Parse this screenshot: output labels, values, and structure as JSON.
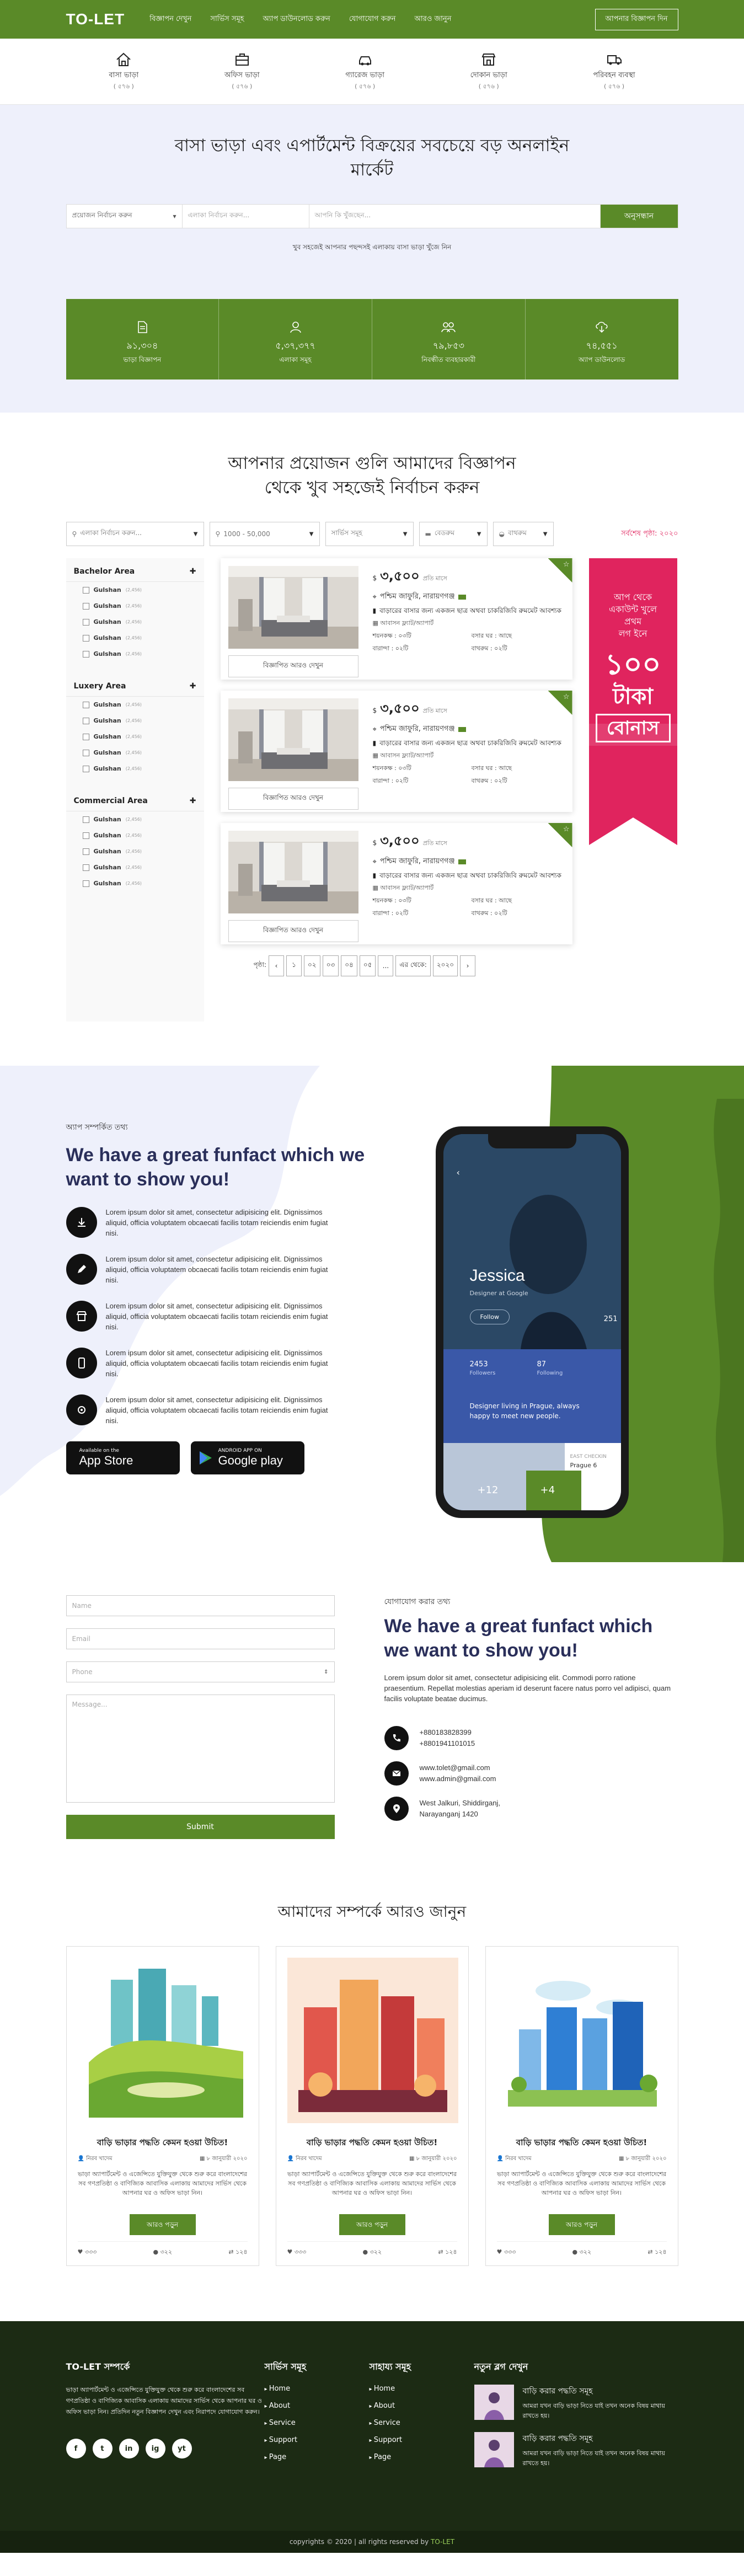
{
  "header": {
    "logo": "TO-LET",
    "nav": [
      "বিজ্ঞাপন দেখুন",
      "সার্ভিস সমূহ",
      "অ্যাপ ডাউনলোড করুন",
      "যোগাযোগ করুন",
      "আরও জানুন"
    ],
    "post_ad": "আপনার বিজ্ঞাপন দিন"
  },
  "categories": [
    {
      "name": "বাসা ভাড়া",
      "count": "( ৫৭৬ )",
      "icon": "house-icon"
    },
    {
      "name": "অফিস ভাড়া",
      "count": "( ৫৭৬ )",
      "icon": "office-icon"
    },
    {
      "name": "গ্যারেজ ভাড়া",
      "count": "( ৫৭৬ )",
      "icon": "garage-icon"
    },
    {
      "name": "দোকান ভাড়া",
      "count": "( ৫৭৬ )",
      "icon": "shop-icon"
    },
    {
      "name": "পরিবহন ব্যবস্থা",
      "count": "( ৫৭৬ )",
      "icon": "truck-icon"
    }
  ],
  "hero": {
    "title": "বাসা ভাড়া এবং এপার্টমেন্ট বিক্রয়ের সবচেয়ে বড় অনলাইন মার্কেট",
    "select": "প্রয়োজন নির্বাচন করুন",
    "location_placeholder": "এলাকা নির্বাচন করুন...",
    "keyword_placeholder": "আপনি কি খুঁজছেন...",
    "search_btn": "অনুসন্ধান",
    "hint": "খুব সহজেই আপনার পছন্দসই এলাকায় বাসা ভাড়া খুঁজে নিন"
  },
  "stats": [
    {
      "value": "৯১,৩০৪",
      "label": "ভাড়া বিজ্ঞাপন",
      "icon": "document-icon"
    },
    {
      "value": "৫,৩৭,৩৭৭",
      "label": "এলাকা সমূহ",
      "icon": "user-icon"
    },
    {
      "value": "৭৯,৮৫৩",
      "label": "নিবন্ধীত ব্যবহারকারী",
      "icon": "users-icon"
    },
    {
      "value": "৭৪,৫৫১",
      "label": "অ্যাপ ডাউনলোড",
      "icon": "download-icon"
    }
  ],
  "listing": {
    "title": "আপনার প্রয়োজন গুলি আমাদের বিজ্ঞাপন থেকে খুব সহজেই নির্বাচন করুন",
    "filters": {
      "area": "এলাকা নির্বাচন করুন...",
      "price": "1000 - 50,000",
      "service": "সার্ভিস সমূহ",
      "room": "বেডরুম",
      "bath": "বাথরুম",
      "special": "সর্বশেষ পৃষ্ঠা: ২০২০"
    },
    "groups": [
      {
        "title": "Bachelor Area",
        "items": [
          {
            "name": "Gulshan",
            "count": "(2,456)"
          },
          {
            "name": "Gulshan",
            "count": "(2,456)"
          },
          {
            "name": "Gulshan",
            "count": "(2,456)"
          },
          {
            "name": "Gulshan",
            "count": "(2,456)"
          },
          {
            "name": "Gulshan",
            "count": "(2,456)"
          }
        ]
      },
      {
        "title": "Luxery Area",
        "items": [
          {
            "name": "Gulshan",
            "count": "(2,456)"
          },
          {
            "name": "Gulshan",
            "count": "(2,456)"
          },
          {
            "name": "Gulshan",
            "count": "(2,456)"
          },
          {
            "name": "Gulshan",
            "count": "(2,456)"
          },
          {
            "name": "Gulshan",
            "count": "(2,456)"
          }
        ]
      },
      {
        "title": "Commercial Area",
        "items": [
          {
            "name": "Gulshan",
            "count": "(2,456)"
          },
          {
            "name": "Gulshan",
            "count": "(2,456)"
          },
          {
            "name": "Gulshan",
            "count": "(2,456)"
          },
          {
            "name": "Gulshan",
            "count": "(2,456)"
          },
          {
            "name": "Gulshan",
            "count": "(2,456)"
          }
        ]
      }
    ],
    "cards": [
      {
        "price": "৩,৫০০",
        "per": "প্রতি মাসে",
        "location": "পশ্চিম জাফুরি, নারায়ণগঞ্জ",
        "title": "বাড়ারের বাসার জন্য একজন ছাত্র অথবা চাকরিজিবি রুমমেট আবশ্যক",
        "type": "আবাসন ফ্ল্যাট/অ্যাপার্ট",
        "f1": "শয়নকক্ষ : ০৩টি",
        "f2": "বসার ঘর : আছে",
        "f3": "বারান্দা : ০২টি",
        "f4": "বাথরুম : ০২টি",
        "details": "বিজ্ঞাপিত আরও দেখুন",
        "badge": "☆"
      },
      {
        "price": "৩,৫০০",
        "per": "প্রতি মাসে",
        "location": "পশ্চিম জাফুরি, নারায়ণগঞ্জ",
        "title": "বাড়ারের বাসার জন্য একজন ছাত্র অথবা চাকরিজিবি রুমমেট আবশ্যক",
        "type": "আবাসন ফ্ল্যাট/অ্যাপার্ট",
        "f1": "শয়নকক্ষ : ০৩টি",
        "f2": "বসার ঘর : আছে",
        "f3": "বারান্দা : ০২টি",
        "f4": "বাথরুম : ০২টি",
        "details": "বিজ্ঞাপিত আরও দেখুন",
        "badge": "☆"
      },
      {
        "price": "৩,৫০০",
        "per": "প্রতি মাসে",
        "location": "পশ্চিম জাফুরি, নারায়ণগঞ্জ",
        "title": "বাড়ারের বাসার জন্য একজন ছাত্র অথবা চাকরিজিবি রুমমেট আবশ্যক",
        "type": "আবাসন ফ্ল্যাট/অ্যাপার্ট",
        "f1": "শয়নকক্ষ : ০৩টি",
        "f2": "বসার ঘর : আছে",
        "f3": "বারান্দা : ০২টি",
        "f4": "বাথরুম : ০২টি",
        "details": "বিজ্ঞাপিত আরও দেখুন",
        "badge": "☆"
      }
    ],
    "pager": {
      "label": "পৃষ্ঠা:",
      "pages": [
        "‹",
        "১",
        "০২",
        "০৩",
        "০৪",
        "০৫",
        "...",
        "এর থেকে:",
        "২০২০",
        "›"
      ]
    },
    "ad": {
      "line1": "আপ থেকে",
      "line2": "একাউন্ট খুলে",
      "line3": "প্রথম",
      "line4": "লগ ইনে",
      "amount": "১০০",
      "unit": "টাকা",
      "bonus": "বোনাস"
    }
  },
  "funfact": {
    "eyebrow": "অ্যাপ সম্পর্কিত তথ্য",
    "title": "We have a great funfact which we want to show you!",
    "items": [
      {
        "text": "Lorem ipsum dolor sit amet, consectetur adipisicing elit. Dignissimos aliquid, officia voluptatem obcaecati facilis totam reiciendis enim fugiat nisi.",
        "icon": "download-icon"
      },
      {
        "text": "Lorem ipsum dolor sit amet, consectetur adipisicing elit. Dignissimos aliquid, officia voluptatem obcaecati facilis totam reiciendis enim fugiat nisi.",
        "icon": "pencil-icon"
      },
      {
        "text": "Lorem ipsum dolor sit amet, consectetur adipisicing elit. Dignissimos aliquid, officia voluptatem obcaecati facilis totam reiciendis enim fugiat nisi.",
        "icon": "store-icon"
      },
      {
        "text": "Lorem ipsum dolor sit amet, consectetur adipisicing elit. Dignissimos aliquid, officia voluptatem obcaecati facilis totam reiciendis enim fugiat nisi.",
        "icon": "phone-icon"
      },
      {
        "text": "Lorem ipsum dolor sit amet, consectetur adipisicing elit. Dignissimos aliquid, officia voluptatem obcaecati facilis totam reiciendis enim fugiat nisi.",
        "icon": "gear-icon"
      }
    ],
    "app_store": {
      "small": "Available on the",
      "big": "App Store"
    },
    "play_store": {
      "small": "ANDROID APP ON",
      "big": "Google play"
    },
    "phone": {
      "name": "Jessica",
      "role": "Designer at Google",
      "follow": "Follow",
      "followers_n": "2453",
      "followers_l": "Followers",
      "following_n": "87",
      "following_l": "Following",
      "count": "251",
      "bio": "Designer living in Prague, always happy to meet new people.",
      "loc1": "EAST CHECKIN",
      "loc2": "Prague 6",
      "plus12": "+12",
      "plus4": "+4"
    }
  },
  "contact": {
    "name_ph": "Name",
    "email_ph": "Email",
    "phone_ph": "Phone",
    "msg_ph": "Message...",
    "submit": "Submit",
    "eyebrow": "যোগাযোগ করার তথ্য",
    "title": "We have a great funfact which we want to show you!",
    "desc": "Lorem ipsum dolor sit amet, consectetur adipisicing elit. Commodi porro ratione praesentium. Repellat molestias aperiam id deserunt facere natus porro vel adipisci, quam facilis voluptate beatae ducimus.",
    "phone1": "+880183828399",
    "phone2": "+8801941101015",
    "email1": "www.tolet@gmail.com",
    "email2": "www.admin@gmail.com",
    "addr1": "West Jalkuri, Shiddirganj,",
    "addr2": "Narayanganj 1420"
  },
  "blog": {
    "title": "আমাদের সম্পর্কে আরও জানুন",
    "posts": [
      {
        "title": "বাড়ি ভাড়ার পদ্ধতি কেমন হওয়া উচিত!",
        "author": "নিরব খাদেম",
        "date": "৮ জানুয়ারী",
        "year": "২০২০",
        "desc": "ভাড়া অ্যাপার্টমেন্ট ও এজেন্সিতে যুক্তিযুক্ত থেকে শুরু করে বাংলাদেশের সব গণপ্রতিষ্ঠা ও বাণিজ্যিক আবাসিক এলাকায় আমাদের সার্ভিস থেকে আপনার ঘর ও অফিস ভাড়া নিন।",
        "more": "আরও পড়ুন",
        "likes": "৩৩৩",
        "comments": "৩২২",
        "shares": "১২৪"
      },
      {
        "title": "বাড়ি ভাড়ার পদ্ধতি কেমন হওয়া উচিত!",
        "author": "নিরব খাদেম",
        "date": "৮ জানুয়ারী",
        "year": "২০২০",
        "desc": "ভাড়া অ্যাপার্টমেন্ট ও এজেন্সিতে যুক্তিযুক্ত থেকে শুরু করে বাংলাদেশের সব গণপ্রতিষ্ঠা ও বাণিজ্যিক আবাসিক এলাকায় আমাদের সার্ভিস থেকে আপনার ঘর ও অফিস ভাড়া নিন।",
        "more": "আরও পড়ুন",
        "likes": "৩৩৩",
        "comments": "৩২২",
        "shares": "১২৪"
      },
      {
        "title": "বাড়ি ভাড়ার পদ্ধতি কেমন হওয়া উচিত!",
        "author": "নিরব খাদেম",
        "date": "৮ জানুয়ারী",
        "year": "২০২০",
        "desc": "ভাড়া অ্যাপার্টমেন্ট ও এজেন্সিতে যুক্তিযুক্ত থেকে শুরু করে বাংলাদেশের সব গণপ্রতিষ্ঠা ও বাণিজ্যিক আবাসিক এলাকায় আমাদের সার্ভিস থেকে আপনার ঘর ও অফিস ভাড়া নিন।",
        "more": "আরও পড়ুন",
        "likes": "৩৩৩",
        "comments": "৩২২",
        "shares": "১২৪"
      }
    ]
  },
  "footer": {
    "about_title": "TO-LET সম্পর্কে",
    "about_text": "ভাড়া অ্যাপার্টমেন্ট ও এজেন্সিতে যুক্তিযুক্ত থেকে শুরু করে বাংলাদেশের সব গণপ্রতিষ্ঠা ও বাণিজ্যিক আবাসিক এলাকায় আমাদের সার্ভিস থেকে আপনার ঘর ও অফিস ভাড়া নিন। প্রতিদিন নতুন বিজ্ঞাপন দেখুন এবং নিরাপদে যোগাযোগ করুন।",
    "services_title": "সার্ভিস সমূহ",
    "services": [
      "Home",
      "About",
      "Service",
      "Support",
      "Page"
    ],
    "help_title": "সাহায্য সমূহ",
    "help": [
      "Home",
      "About",
      "Service",
      "Support",
      "Page"
    ],
    "blog_title": "নতুন ব্লগ দেখুন",
    "posts": [
      {
        "title": "বাড়ি করার পদ্ধতি সমূহ",
        "desc": "আমরা যখন বাড়ি ভাড়া নিতে যাই তখন অনেক বিষয় মাথায় রাখতে হয়।"
      },
      {
        "title": "বাড়ি করার পদ্ধতি সমূহ",
        "desc": "আমরা যখন বাড়ি ভাড়া নিতে যাই তখন অনেক বিষয় মাথায় রাখতে হয়।"
      }
    ],
    "socials": [
      "f",
      "t",
      "in",
      "ig",
      "yt"
    ],
    "copy_pre": "copyrights © 2020 | all rights reserved by",
    "copy_brand": "TO-LET"
  },
  "colors": {
    "brand": "#5a8a28",
    "dark": "#1c2b14",
    "hero_bg": "#eef0fb",
    "accent": "#e0245e"
  }
}
